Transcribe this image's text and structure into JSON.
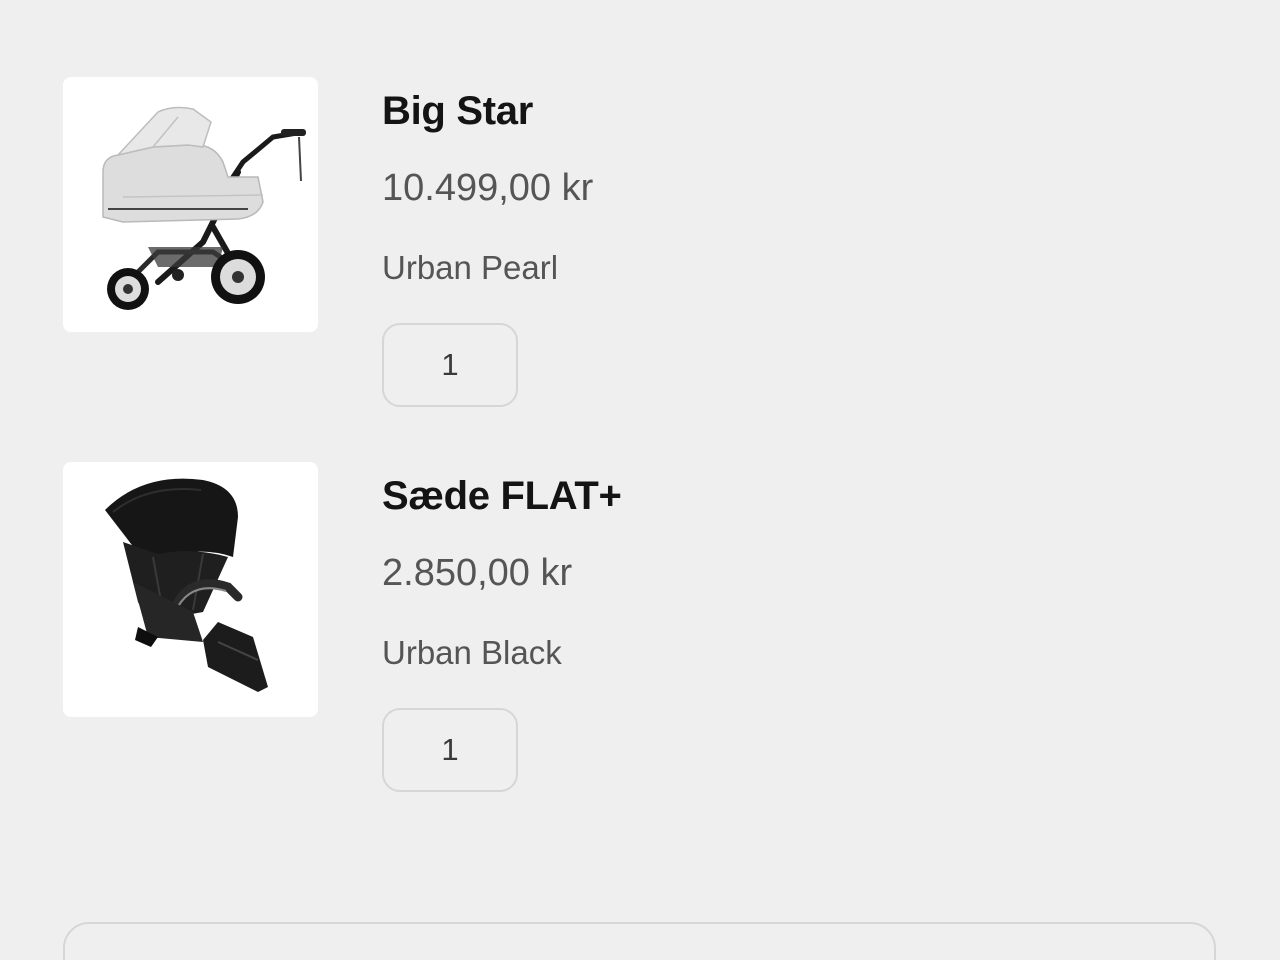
{
  "cart": {
    "items": [
      {
        "name": "Big Star",
        "price": "10.499,00 kr",
        "variant": "Urban Pearl",
        "quantity": "1",
        "image": "light-grey-pram-with-carrycot"
      },
      {
        "name": "Sæde FLAT+",
        "price": "2.850,00 kr",
        "variant": "Urban Black",
        "quantity": "1",
        "image": "black-stroller-seat"
      }
    ]
  },
  "colors": {
    "background": "#efefef",
    "title": "#141414",
    "secondary_text": "#555555",
    "border": "#d6d6d6"
  }
}
